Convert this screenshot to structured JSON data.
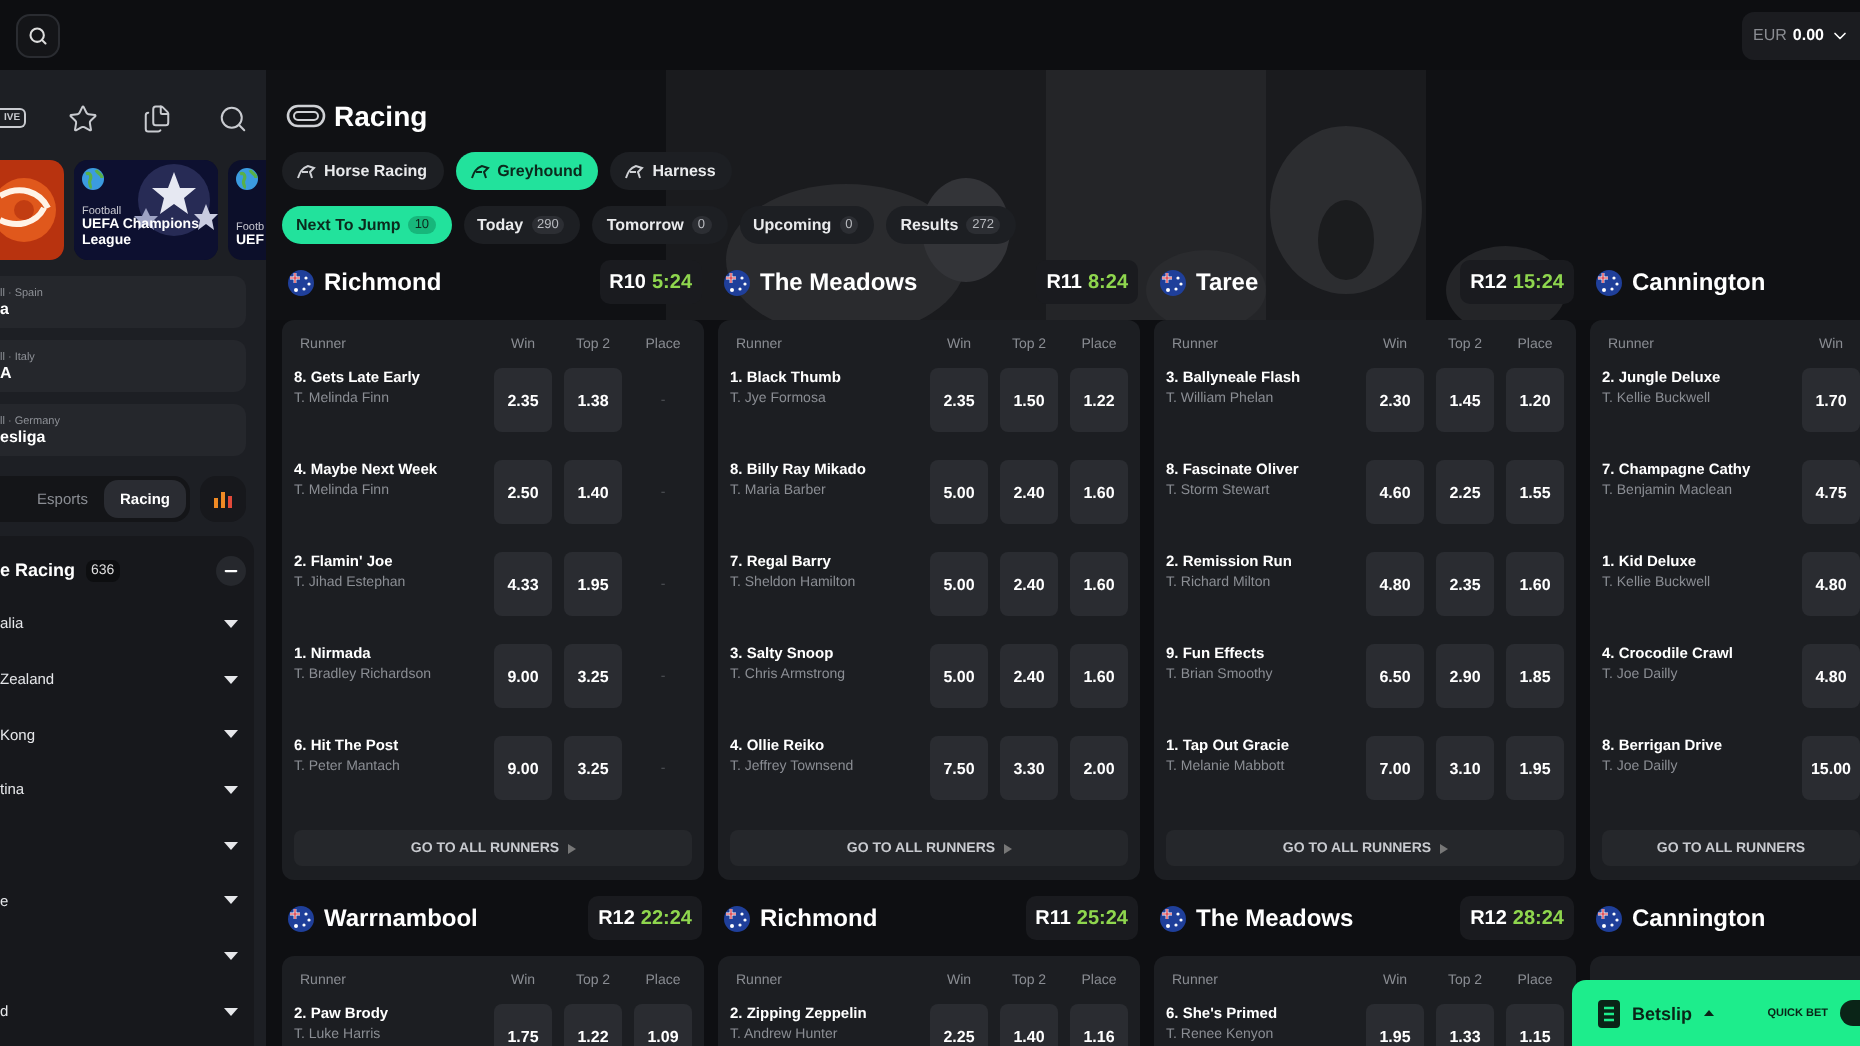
{
  "header": {
    "balance": {
      "currency": "EUR",
      "amount": "0.00"
    }
  },
  "sidebar": {
    "live": "IVE",
    "featured": [
      {
        "kind": "picture"
      },
      {
        "kind": "league",
        "sport": "Football",
        "title": "UEFA Champions League"
      },
      {
        "kind": "league",
        "sport": "Footb",
        "title": "UEF"
      }
    ],
    "leagues": [
      {
        "meta": "ll · Spain",
        "name": "a"
      },
      {
        "meta": "ll · Italy",
        "name": "A"
      },
      {
        "meta": "ll · Germany",
        "name": "esliga"
      }
    ],
    "tabs": [
      {
        "label": "Esports",
        "selected": false
      },
      {
        "label": "Racing",
        "selected": true
      }
    ],
    "racing": {
      "title": "e Racing",
      "count": "636",
      "expanded": true,
      "countries": [
        {
          "label": "alia",
          "expanded": false
        },
        {
          "label": "Zealand",
          "expanded": false
        },
        {
          "label": "Kong",
          "expanded": false
        },
        {
          "label": "tina",
          "expanded": false
        },
        {
          "expanded": false
        },
        {
          "label": "e",
          "expanded": false
        },
        {
          "expanded": false
        },
        {
          "label": "d",
          "expanded": false
        }
      ]
    }
  },
  "page": {
    "title": "Racing",
    "categories": [
      {
        "label": "Horse Racing",
        "selected": false
      },
      {
        "label": "Greyhound",
        "selected": true
      },
      {
        "label": "Harness",
        "selected": false
      }
    ],
    "filters": [
      {
        "label": "Next To Jump",
        "count": "10",
        "selected": true
      },
      {
        "label": "Today",
        "count": "290",
        "selected": false
      },
      {
        "label": "Tomorrow",
        "count": "0",
        "selected": false
      },
      {
        "label": "Upcoming",
        "count": "0",
        "selected": false
      },
      {
        "label": "Results",
        "count": "272",
        "selected": false
      }
    ]
  },
  "meetings": [
    {
      "venue": "Richmond",
      "race": "R10",
      "time": "5:24",
      "place_open": false,
      "columns": [
        "Runner",
        "Win",
        "Top 2",
        "Place"
      ],
      "runners": [
        {
          "name": "8. Gets Late Early",
          "trainer": "T. Melinda Finn",
          "odds": [
            "2.35",
            "1.38",
            "-"
          ]
        },
        {
          "name": "4. Maybe Next Week",
          "trainer": "T. Melinda Finn",
          "odds": [
            "2.50",
            "1.40",
            "-"
          ]
        },
        {
          "name": "2. Flamin' Joe",
          "trainer": "T. Jihad Estephan",
          "odds": [
            "4.33",
            "1.95",
            "-"
          ]
        },
        {
          "name": "1. Nirmada",
          "trainer": "T. Bradley Richardson",
          "odds": [
            "9.00",
            "3.25",
            "-"
          ]
        },
        {
          "name": "6. Hit The Post",
          "trainer": "T. Peter Mantach",
          "odds": [
            "9.00",
            "3.25",
            "-"
          ]
        }
      ],
      "footer": {
        "label": "GO TO ALL RUNNERS",
        "arrow": true
      }
    },
    {
      "venue": "The Meadows",
      "race": "R11",
      "time": "8:24",
      "place_open": true,
      "columns": [
        "Runner",
        "Win",
        "Top 2",
        "Place"
      ],
      "runners": [
        {
          "name": "1. Black Thumb",
          "trainer": "T. Jye Formosa",
          "odds": [
            "2.35",
            "1.50",
            "1.22"
          ]
        },
        {
          "name": "8. Billy Ray Mikado",
          "trainer": "T. Maria Barber",
          "odds": [
            "5.00",
            "2.40",
            "1.60"
          ]
        },
        {
          "name": "7. Regal Barry",
          "trainer": "T. Sheldon Hamilton",
          "odds": [
            "5.00",
            "2.40",
            "1.60"
          ]
        },
        {
          "name": "3. Salty Snoop",
          "trainer": "T. Chris Armstrong",
          "odds": [
            "5.00",
            "2.40",
            "1.60"
          ]
        },
        {
          "name": "4. Ollie Reiko",
          "trainer": "T. Jeffrey Townsend",
          "odds": [
            "7.50",
            "3.30",
            "2.00"
          ]
        }
      ],
      "footer": {
        "label": "GO TO ALL RUNNERS",
        "arrow": true
      }
    },
    {
      "venue": "Taree",
      "race": "R12",
      "time": "15:24",
      "place_open": true,
      "columns": [
        "Runner",
        "Win",
        "Top 2",
        "Place"
      ],
      "runners": [
        {
          "name": "3. Ballyneale Flash",
          "trainer": "T. William Phelan",
          "odds": [
            "2.30",
            "1.45",
            "1.20"
          ]
        },
        {
          "name": "8. Fascinate Oliver",
          "trainer": "T. Storm Stewart",
          "odds": [
            "4.60",
            "2.25",
            "1.55"
          ]
        },
        {
          "name": "2. Remission Run",
          "trainer": "T. Richard Milton",
          "odds": [
            "4.80",
            "2.35",
            "1.60"
          ]
        },
        {
          "name": "9. Fun Effects",
          "trainer": "T. Brian Smoothy",
          "odds": [
            "6.50",
            "2.90",
            "1.85"
          ]
        },
        {
          "name": "1. Tap Out Gracie",
          "trainer": "T. Melanie Mabbott",
          "odds": [
            "7.00",
            "3.10",
            "1.95"
          ]
        }
      ],
      "footer": {
        "label": "GO TO ALL RUNNERS",
        "arrow": true
      }
    },
    {
      "venue": "Cannington",
      "columns": [
        "Runner",
        "Win"
      ],
      "runners": [
        {
          "name": "2. Jungle Deluxe",
          "trainer": "T. Kellie Buckwell",
          "odds": [
            "1.70"
          ]
        },
        {
          "name": "7. Champagne Cathy",
          "trainer": "T. Benjamin Maclean",
          "odds": [
            "4.75"
          ]
        },
        {
          "name": "1. Kid Deluxe",
          "trainer": "T. Kellie Buckwell",
          "odds": [
            "4.80"
          ]
        },
        {
          "name": "4. Crocodile Crawl",
          "trainer": "T. Joe Dailly",
          "odds": [
            "4.80"
          ]
        },
        {
          "name": "8. Berrigan Drive",
          "trainer": "T. Joe Dailly",
          "odds": [
            "15.00"
          ]
        }
      ],
      "footer": {
        "label": "GO TO ALL RUNNERS",
        "arrow": false
      }
    },
    {
      "venue": "Warrnambool",
      "race": "R12",
      "time": "22:24",
      "place_open": true,
      "columns": [
        "Runner",
        "Win",
        "Top 2",
        "Place"
      ],
      "runners": [
        {
          "name": "2. Paw Brody",
          "trainer": "T. Luke Harris",
          "odds": [
            "1.75",
            "1.22",
            "1.09"
          ]
        }
      ]
    },
    {
      "venue": "Richmond",
      "race": "R11",
      "time": "25:24",
      "place_open": true,
      "columns": [
        "Runner",
        "Win",
        "Top 2",
        "Place"
      ],
      "runners": [
        {
          "name": "2. Zipping Zeppelin",
          "trainer": "T. Andrew Hunter",
          "odds": [
            "2.25",
            "1.40",
            "1.16"
          ]
        }
      ]
    },
    {
      "venue": "The Meadows",
      "race": "R12",
      "time": "28:24",
      "place_open": true,
      "columns": [
        "Runner",
        "Win",
        "Top 2",
        "Place"
      ],
      "runners": [
        {
          "name": "6. She's Primed",
          "trainer": "T. Renee Kenyon",
          "odds": [
            "1.95",
            "1.33",
            "1.15"
          ]
        }
      ]
    },
    {
      "venue": "Cannington"
    }
  ],
  "betslip": {
    "label": "Betslip",
    "quick_bet": "QUICK BET"
  }
}
